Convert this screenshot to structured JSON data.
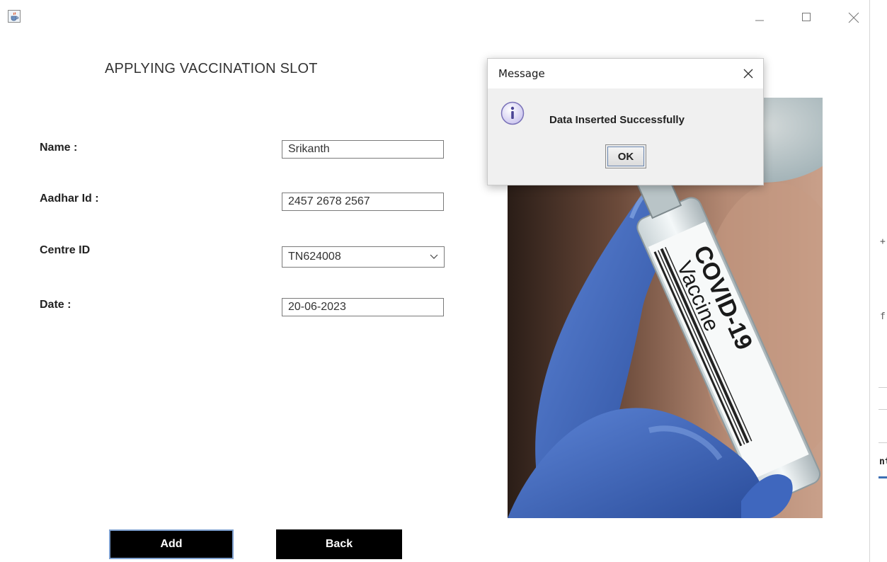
{
  "window": {
    "app_icon": "java-cup-icon",
    "controls": {
      "minimize": "minimize-icon",
      "maximize": "maximize-icon",
      "close": "close-icon"
    }
  },
  "form": {
    "title": "APPLYING VACCINATION SLOT",
    "fields": [
      {
        "label": "Name :",
        "value": "Srikanth"
      },
      {
        "label": "Aadhar Id :",
        "value": "2457 2678 2567"
      },
      {
        "label": "Centre ID",
        "value": "TN624008"
      },
      {
        "label": "Date :",
        "value": "20-06-2023"
      }
    ],
    "buttons": {
      "add": "Add",
      "back": "Back"
    }
  },
  "image": {
    "vial_line1": "COVID-19",
    "vial_line2": "Vaccine"
  },
  "dialog": {
    "title": "Message",
    "icon": "info-icon",
    "message": "Data Inserted Successfully",
    "ok_label": "OK"
  },
  "edge_panel": {
    "glyphs": [
      "+",
      "f",
      "nt"
    ]
  },
  "colors": {
    "button_bg": "#000000",
    "button_text": "#ffffff",
    "focus_border": "#7ea0cf",
    "dialog_bg": "#f0f0f0",
    "glove_blue": "#3b63b8"
  }
}
